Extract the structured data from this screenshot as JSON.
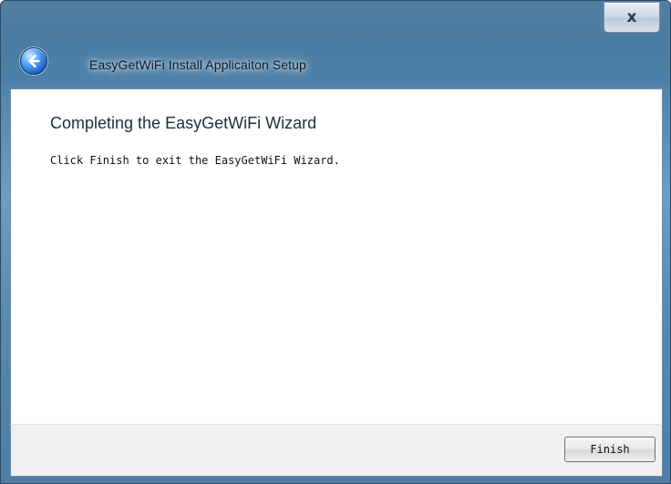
{
  "window": {
    "title": "EasyGetWiFi Install Applicaiton Setup",
    "close_symbol": "x"
  },
  "page": {
    "heading": "Completing the EasyGetWiFi Wizard",
    "description": "Click Finish to exit the EasyGetWiFi Wizard."
  },
  "buttons": {
    "finish_label": "Finish"
  },
  "icons": {
    "back": "back-arrow-icon",
    "close": "close-icon"
  },
  "colors": {
    "titlebar": "#4f84ad",
    "content_bg": "#ffffff",
    "footer_bg": "#f0f0f0"
  }
}
